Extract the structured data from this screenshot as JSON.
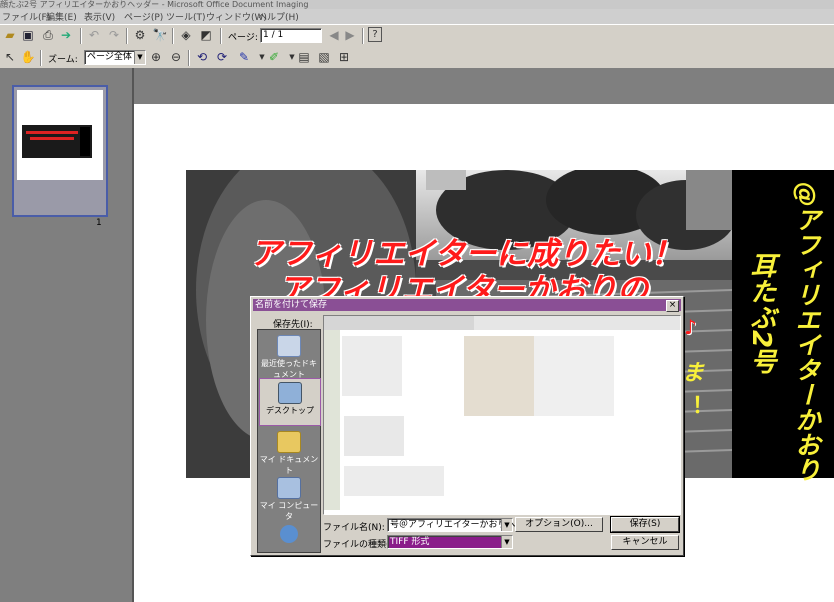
{
  "window": {
    "title": "顔たぶ2号 アフィリエイターかおりヘッダー - Microsoft Office Document Imaging"
  },
  "menu": [
    "ファイル(F)",
    "編集(E)",
    "表示(V)",
    "ページ(P)",
    "ツール(T)",
    "ウィンドウ(W)",
    "ヘルプ(H)"
  ],
  "toolbar": {
    "page_label": "ページ:",
    "page_value": "1 / 1",
    "zoom_label": "ズーム:",
    "zoom_value": "ページ全体"
  },
  "thumbnails": [
    {
      "number": "1"
    }
  ],
  "document_image": {
    "headline_line1": "アフィリエイターに成りたい！",
    "headline_line2": "アフィリエイターかおりの",
    "side_text_1": "耳たぶ2号",
    "side_text_2": "@アフィリエイターかおり",
    "partial_right_1": "♪",
    "partial_right_2": "ま",
    "partial_right_3": "！"
  },
  "dialog": {
    "title": "名前を付けて保存",
    "save_in_label": "保存先(I):",
    "places": [
      {
        "label": "最近使ったドキュメント",
        "icon": "recent-documents-icon"
      },
      {
        "label": "デスクトップ",
        "icon": "desktop-icon"
      },
      {
        "label": "マイ ドキュメント",
        "icon": "my-documents-icon"
      },
      {
        "label": "マイ コンピュータ",
        "icon": "my-computer-icon"
      }
    ],
    "filename_label": "ファイル名(N):",
    "filename_value": "号＠アフィリエイターかおりヘッダー",
    "filetype_label": "ファイルの種類(T):",
    "filetype_value": "TIFF 形式",
    "options_button": "オプション(O)...",
    "save_button": "保存(S)",
    "cancel_button": "キャンセル",
    "close_symbol": "×"
  },
  "colors": {
    "dialog_title_bg": "#8a4f95",
    "headline_red": "#ff1a1a",
    "side_yellow": "#f8f03a"
  }
}
